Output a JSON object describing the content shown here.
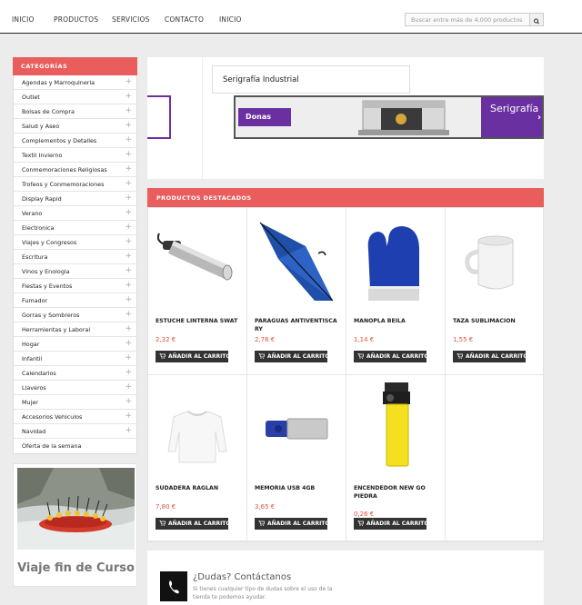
{
  "nav": {
    "items": [
      "INICIO",
      "PRODUCTOS",
      "SERVICIOS",
      "CONTACTO",
      "INICIO"
    ],
    "search_placeholder": "Buscar entre más de 4.000 productos"
  },
  "sidebar": {
    "header": "CATEGORÍAS",
    "categories": [
      "Agendas y Marroquineria",
      "Outlet",
      "Bolsas de Compra",
      "Salud y Aseo",
      "Complementos y Detalles",
      "Textil Invierno",
      "Conmemoraciones Religiosas",
      "Trofeos y Conmemoraciones",
      "Display Rapid",
      "Verano",
      "Electronica",
      "Viajes y Congresos",
      "Escritura",
      "Vinos y Enologia",
      "Fiestas y Eventos",
      "Fumador",
      "Gorras y Sombreros",
      "Herramientas y Laboral",
      "Hogar",
      "Infantil",
      "Calendarios",
      "Llaveros",
      "Mujer",
      "Accesorios Vehiculos",
      "Navidad",
      "Oferta de la semana"
    ],
    "promo_text": "Viaje fin de Curso"
  },
  "banner": {
    "title": "Serigrafía Industrial",
    "slide_left_label": "Donas",
    "slide_right_label": "Serigrafía Industri"
  },
  "products": {
    "header": "PRODUCTOS DESTACADOS",
    "cart_label": "AÑADIR AL CARRITO",
    "items": [
      {
        "name": "ESTUCHE LINTERNA SWAT",
        "price": "2,32 €",
        "icon": "flashlight-icon"
      },
      {
        "name": "PARAGUAS ANTIVENTISCA RY",
        "price": "2,76 €",
        "icon": "umbrella-icon"
      },
      {
        "name": "MANOPLA BEILA",
        "price": "1,14 €",
        "icon": "oven-mitt-icon"
      },
      {
        "name": "TAZA SUBLIMACION",
        "price": "1,55 €",
        "icon": "mug-icon"
      },
      {
        "name": "SUDADERA RAGLAN",
        "price": "7,80 €",
        "icon": "sweatshirt-icon"
      },
      {
        "name": "MEMORIA USB 4GB",
        "price": "3,65 €",
        "icon": "usb-icon"
      },
      {
        "name": "ENCENDEDOR NEW GO PIEDRA",
        "price": "0,26 €",
        "icon": "lighter-icon"
      }
    ]
  },
  "contact": {
    "title": "¿Dudas? Contáctanos",
    "subtitle": "Si tienes cualquier tipo de dudas sobre el uso de la tienda te podemos ayudar."
  }
}
